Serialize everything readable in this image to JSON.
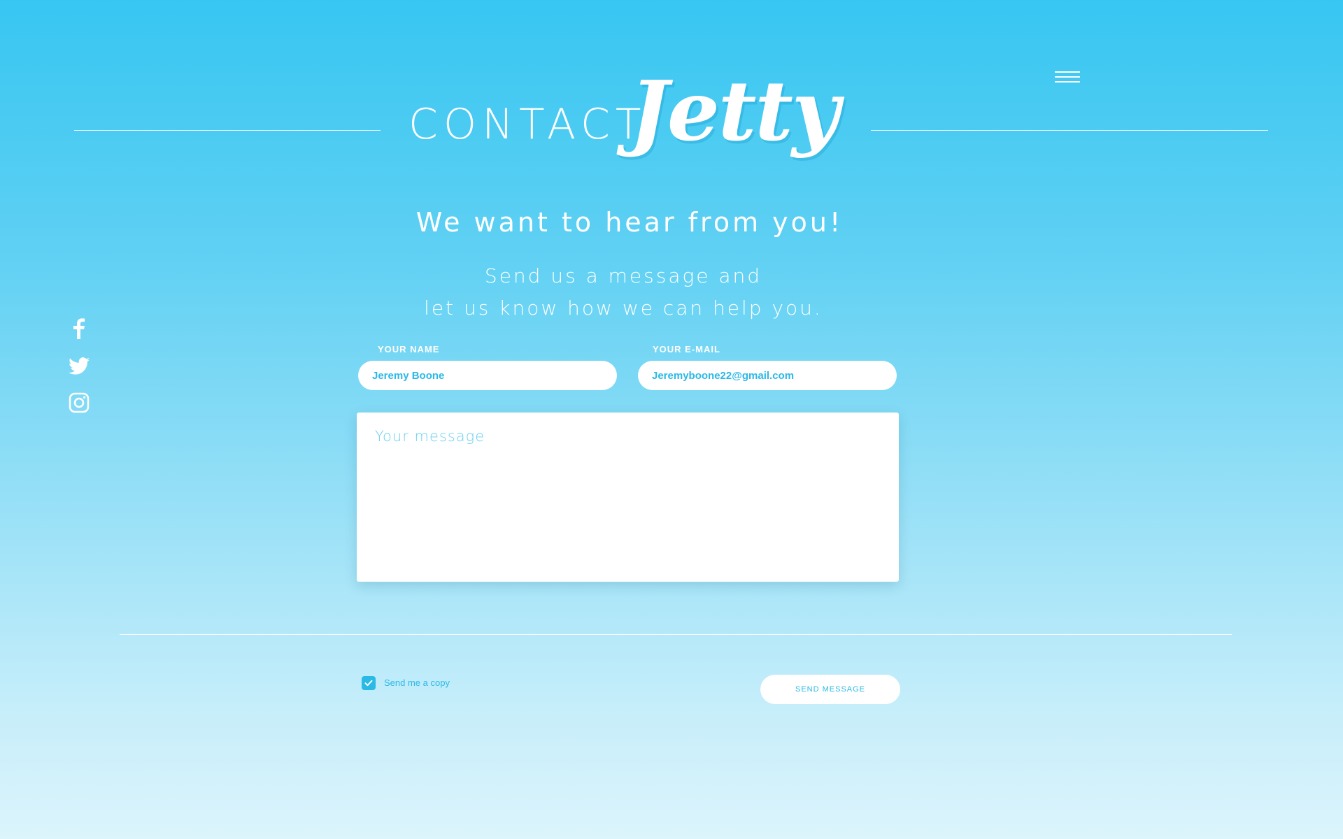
{
  "header": {
    "menu_icon": "hamburger-menu-icon",
    "brand_contact": "CONTACT",
    "brand_script": "Jetty"
  },
  "hero": {
    "headline": "We want to hear from you!",
    "subline_1": "Send us a message and",
    "subline_2": "let us know how we can help you."
  },
  "social": [
    {
      "icon": "facebook-icon"
    },
    {
      "icon": "twitter-icon"
    },
    {
      "icon": "instagram-icon"
    }
  ],
  "form": {
    "name_label": "YOUR NAME",
    "name_value": "Jeremy Boone",
    "email_label": "YOUR E-MAIL",
    "email_value": "Jeremyboone22@gmail.com",
    "message_placeholder": "Your message",
    "copy_label": "Send me a copy",
    "copy_checked": true,
    "send_label": "SEND MESSAGE"
  },
  "colors": {
    "background_top": "#37c6f2",
    "background_bottom": "#dcf4fc",
    "accent": "#2bb9e6",
    "white": "#ffffff"
  }
}
